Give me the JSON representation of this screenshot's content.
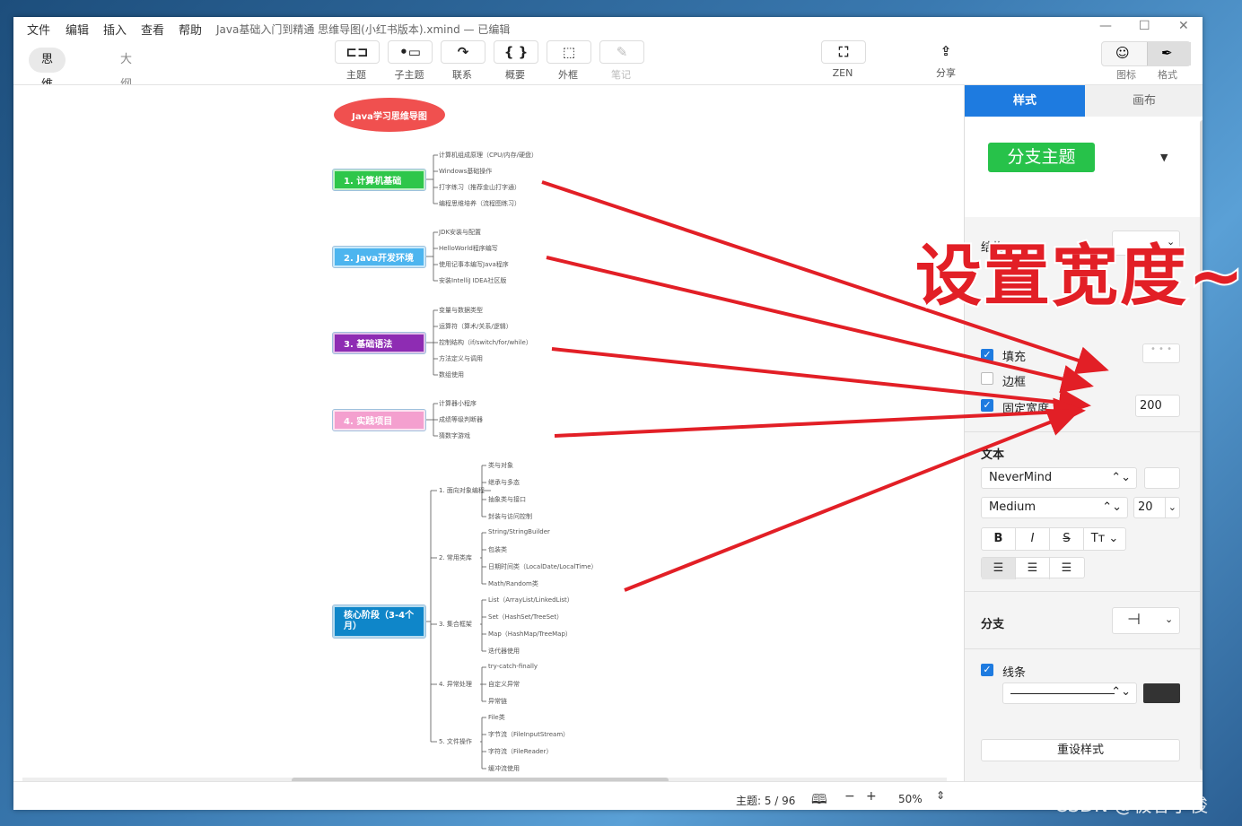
{
  "menu": [
    "文件",
    "编辑",
    "插入",
    "查看",
    "帮助"
  ],
  "doc_title": "Java基础入门到精通 思维导图(小红书版本).xmind — 已编辑",
  "view_tabs": {
    "mindmap": "思维导图",
    "outline": "大纲"
  },
  "toolbar": [
    {
      "label": "主题",
      "icon": "⊏⊐"
    },
    {
      "label": "子主题",
      "icon": "•▭"
    },
    {
      "label": "联系",
      "icon": "↷"
    },
    {
      "label": "概要",
      "icon": "{ }"
    },
    {
      "label": "外框",
      "icon": "⬚"
    },
    {
      "label": "笔记",
      "icon": "✎"
    }
  ],
  "zen_label": "ZEN",
  "share_label": "分享",
  "right_toggle": {
    "icon_label": "图标",
    "format_label": "格式"
  },
  "mindmap": {
    "central": "Java学习思维导图",
    "branches": [
      {
        "label": "1. 计算机基础",
        "color": "#2ec64a",
        "leaves": [
          "计算机组成原理（CPU/内存/硬盘）",
          "Windows基础操作",
          "打字练习（推荐金山打字通）",
          "编程思维培养（流程图练习）"
        ]
      },
      {
        "label": "2. Java开发环境",
        "color": "#4db5ef",
        "leaves": [
          "JDK安装与配置",
          "HelloWorld程序编写",
          "使用记事本编写Java程序",
          "安装IntelliJ IDEA社区版"
        ]
      },
      {
        "label": "3. 基础语法",
        "color": "#8e2cb3",
        "leaves": [
          "变量与数据类型",
          "运算符（算术/关系/逻辑）",
          "控制结构（if/switch/for/while）",
          "方法定义与调用",
          "数组使用"
        ]
      },
      {
        "label": "4. 实践项目",
        "color": "#f4a0cf",
        "leaves": [
          "计算器小程序",
          "成绩等级判断器",
          "猜数字游戏"
        ]
      },
      {
        "label": "核心阶段（3-4个月）",
        "color": "#0f86c9",
        "subs": [
          {
            "label": "1. 面向对象编程",
            "leaves": [
              "类与对象",
              "继承与多态",
              "抽象类与接口",
              "封装与访问控制"
            ]
          },
          {
            "label": "2. 常用类库",
            "leaves": [
              "String/StringBuilder",
              "包装类",
              "日期时间类（LocalDate/LocalTime）",
              "Math/Random类"
            ]
          },
          {
            "label": "3. 集合框架",
            "leaves": [
              "List（ArrayList/LinkedList）",
              "Set（HashSet/TreeSet）",
              "Map（HashMap/TreeMap）",
              "迭代器使用"
            ]
          },
          {
            "label": "4. 异常处理",
            "leaves": [
              "try-catch-finally",
              "自定义异常",
              "异常链"
            ]
          },
          {
            "label": "5. 文件操作",
            "leaves": [
              "File类",
              "字节流（FileInputStream）",
              "字符流（FileReader）",
              "缓冲流使用"
            ]
          }
        ]
      }
    ]
  },
  "panel": {
    "tab_style": "样式",
    "tab_canvas": "画布",
    "topic_type": "分支主题",
    "structure_label": "结构",
    "fill_label": "填充",
    "border_label": "边框",
    "fixed_width_label": "固定宽度",
    "fixed_width_value": "200",
    "text_label": "文本",
    "font_family": "NeverMind",
    "font_weight": "Medium",
    "font_size": "20",
    "branch_label": "分支",
    "line_label": "线条",
    "reset_label": "重设样式"
  },
  "status": {
    "topics": "主题: 5 / 96",
    "zoom": "50%"
  },
  "annotation": "设置宽度~",
  "watermark": "CSDN @极客小俊"
}
